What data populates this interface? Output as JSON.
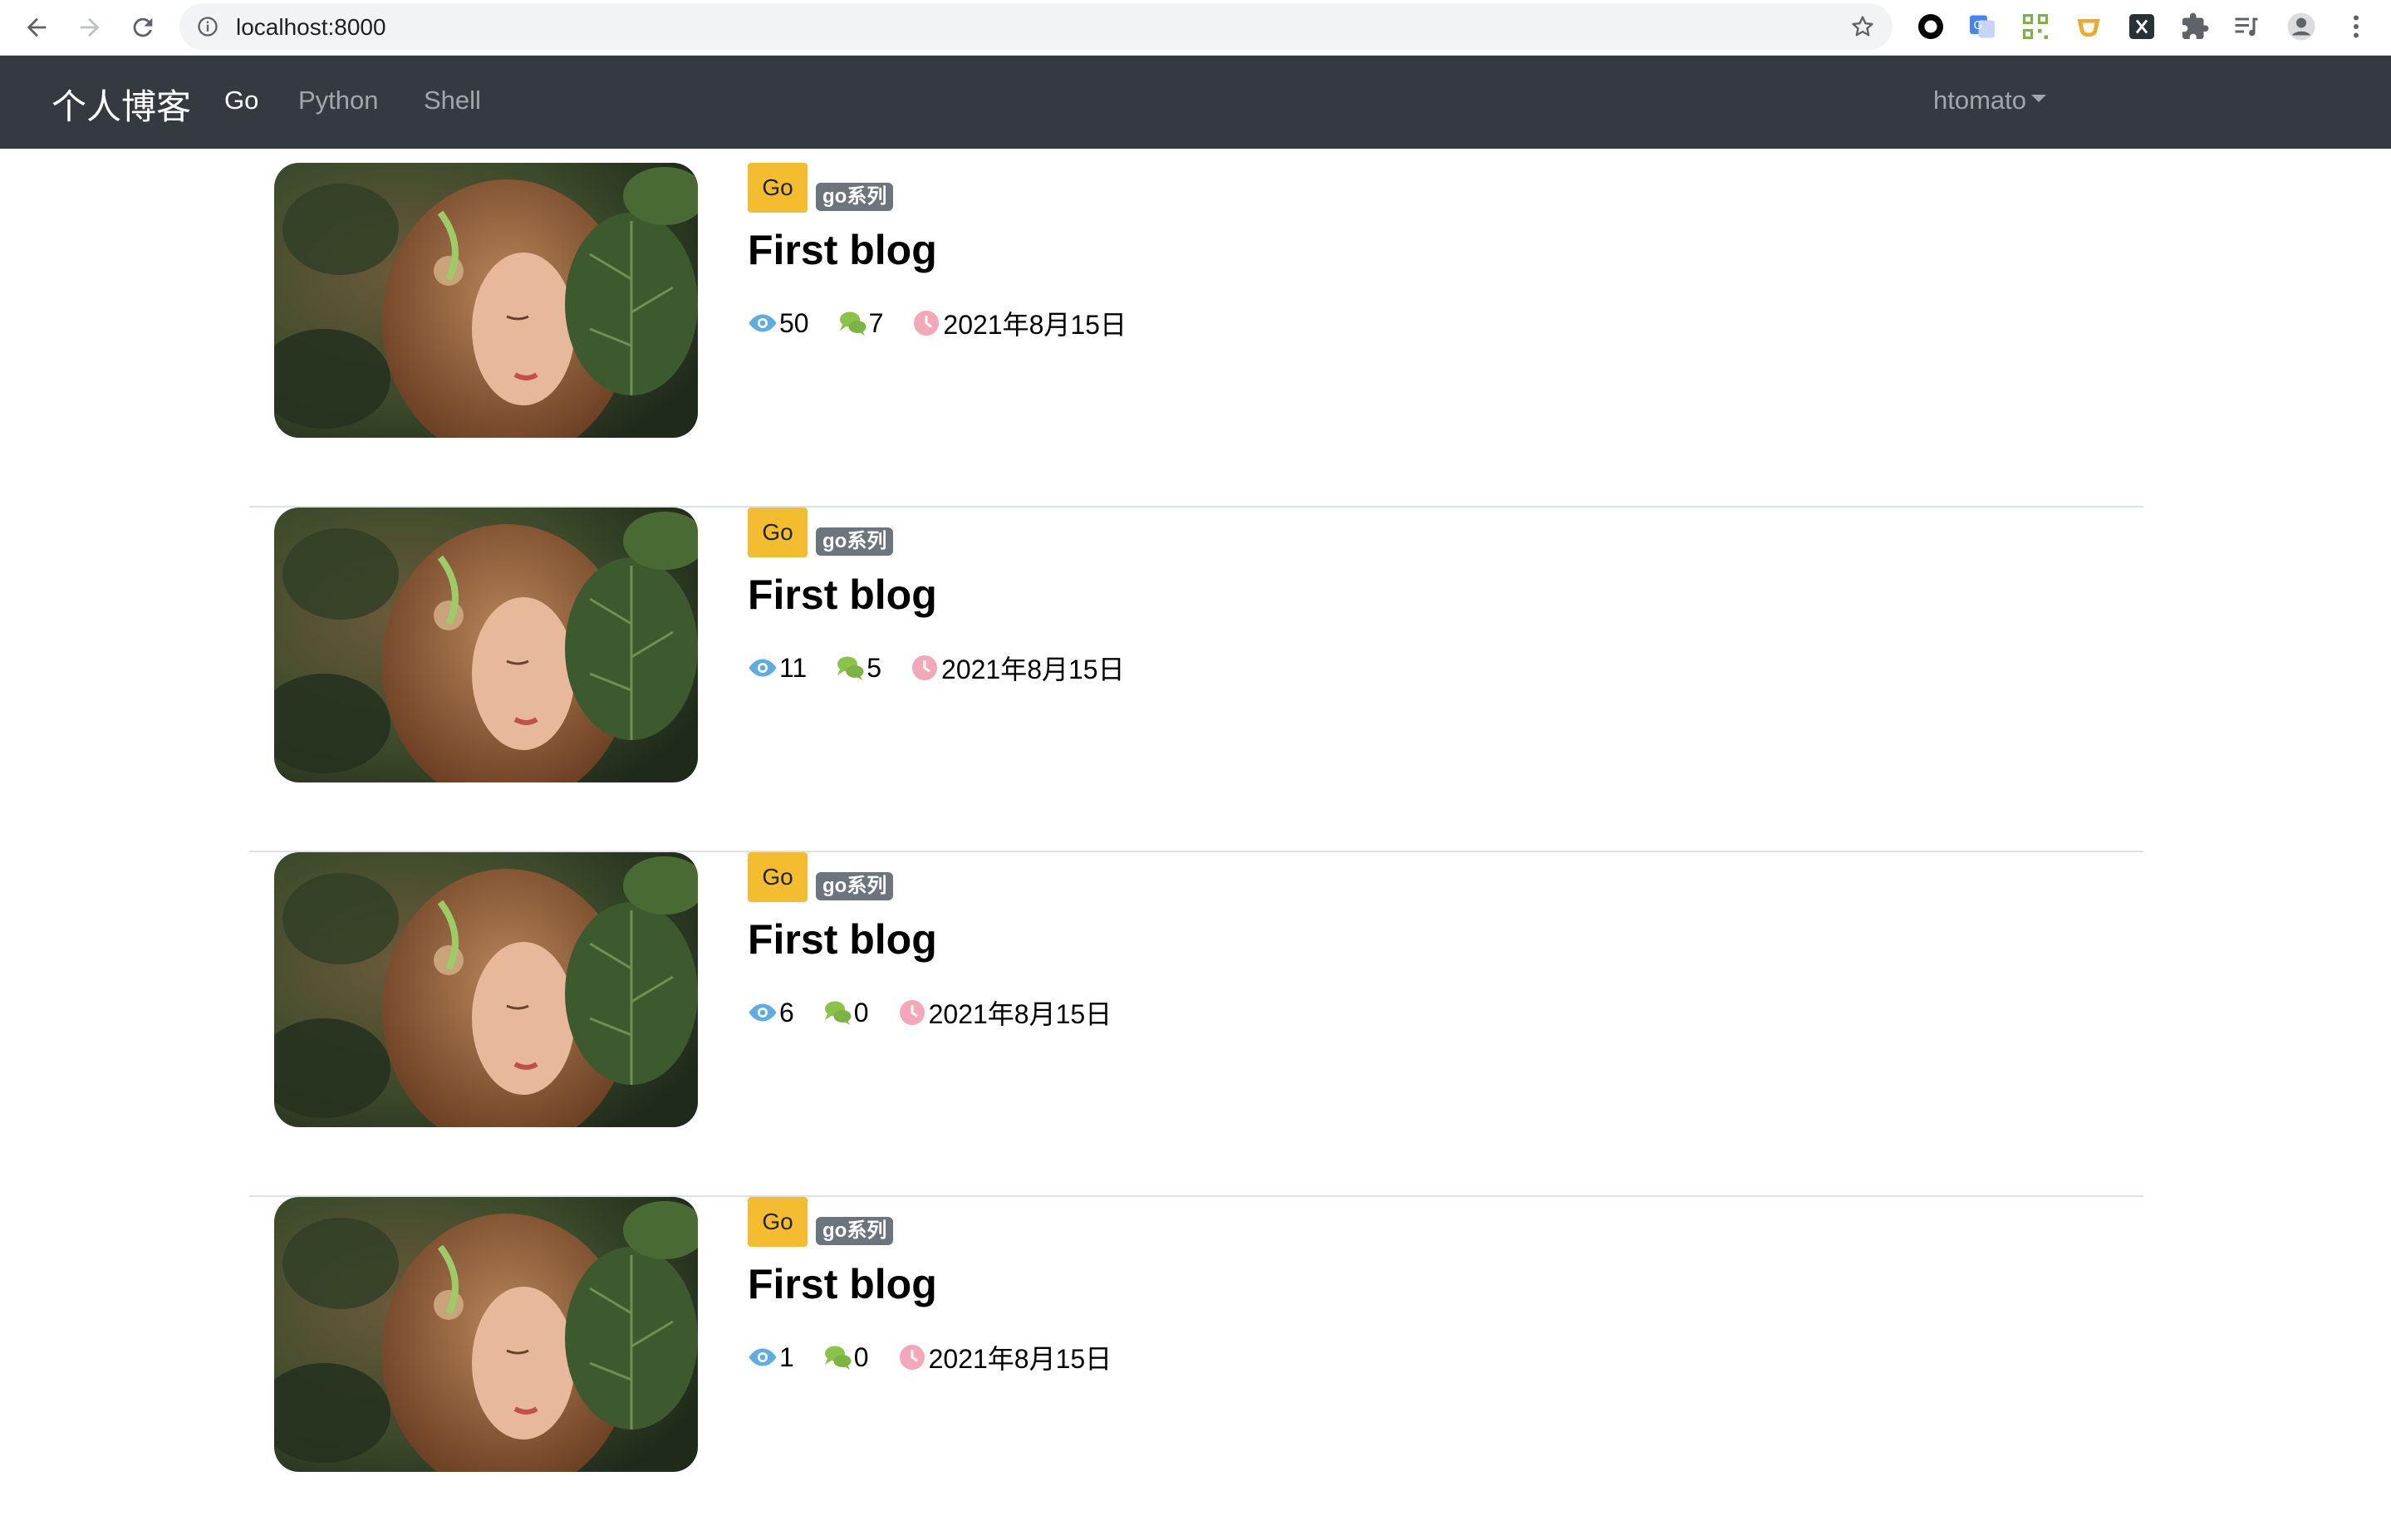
{
  "browser": {
    "url": "localhost:8000",
    "icons": [
      "back-arrow-icon",
      "forward-arrow-icon",
      "reload-icon",
      "info-icon",
      "star-icon",
      "circle-extension-icon",
      "translate-extension-icon",
      "qr-extension-icon",
      "cup-extension-icon",
      "x-extension-icon",
      "puzzle-icon",
      "media-queue-icon",
      "profile-icon",
      "more-vert-icon"
    ]
  },
  "navbar": {
    "brand": "个人博客",
    "links": [
      {
        "label": "Go",
        "active": true
      },
      {
        "label": "Python",
        "active": false
      },
      {
        "label": "Shell",
        "active": false
      }
    ],
    "user": "htomato",
    "bg_color": "#343a40"
  },
  "posts": [
    {
      "category": "Go",
      "tag": "go系列",
      "title": "First blog",
      "views": "50",
      "comments": "7",
      "date": "2021年8月15日"
    },
    {
      "category": "Go",
      "tag": "go系列",
      "title": "First blog",
      "views": "11",
      "comments": "5",
      "date": "2021年8月15日"
    },
    {
      "category": "Go",
      "tag": "go系列",
      "title": "First blog",
      "views": "6",
      "comments": "0",
      "date": "2021年8月15日"
    },
    {
      "category": "Go",
      "tag": "go系列",
      "title": "First blog",
      "views": "1",
      "comments": "0",
      "date": "2021年8月15日"
    }
  ],
  "colors": {
    "category_badge": "#f4bd2f",
    "tag_badge": "#6c757d",
    "views_icon": "#5dade2",
    "comments_icon": "#8bc34a",
    "date_icon": "#f4a7b9"
  }
}
